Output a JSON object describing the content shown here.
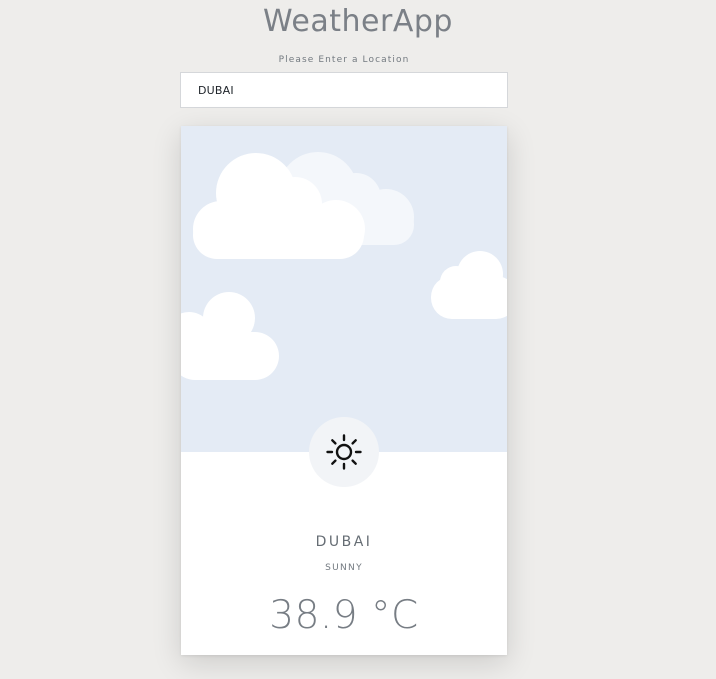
{
  "app": {
    "title": "WeatherApp"
  },
  "search": {
    "label": "Please Enter a Location",
    "value": "DUBAI"
  },
  "weather": {
    "city": "DUBAI",
    "condition": "SUNNY",
    "temperature": "38.9 °C",
    "icon": "sun-icon"
  },
  "colors": {
    "page_background": "#eeedeb",
    "sky_background": "#e4ebf5",
    "cloud": "#ffffff",
    "cloud_faded": "#f4f7fb",
    "icon_circle": "#f2f4f7",
    "text_muted": "#737a80"
  }
}
